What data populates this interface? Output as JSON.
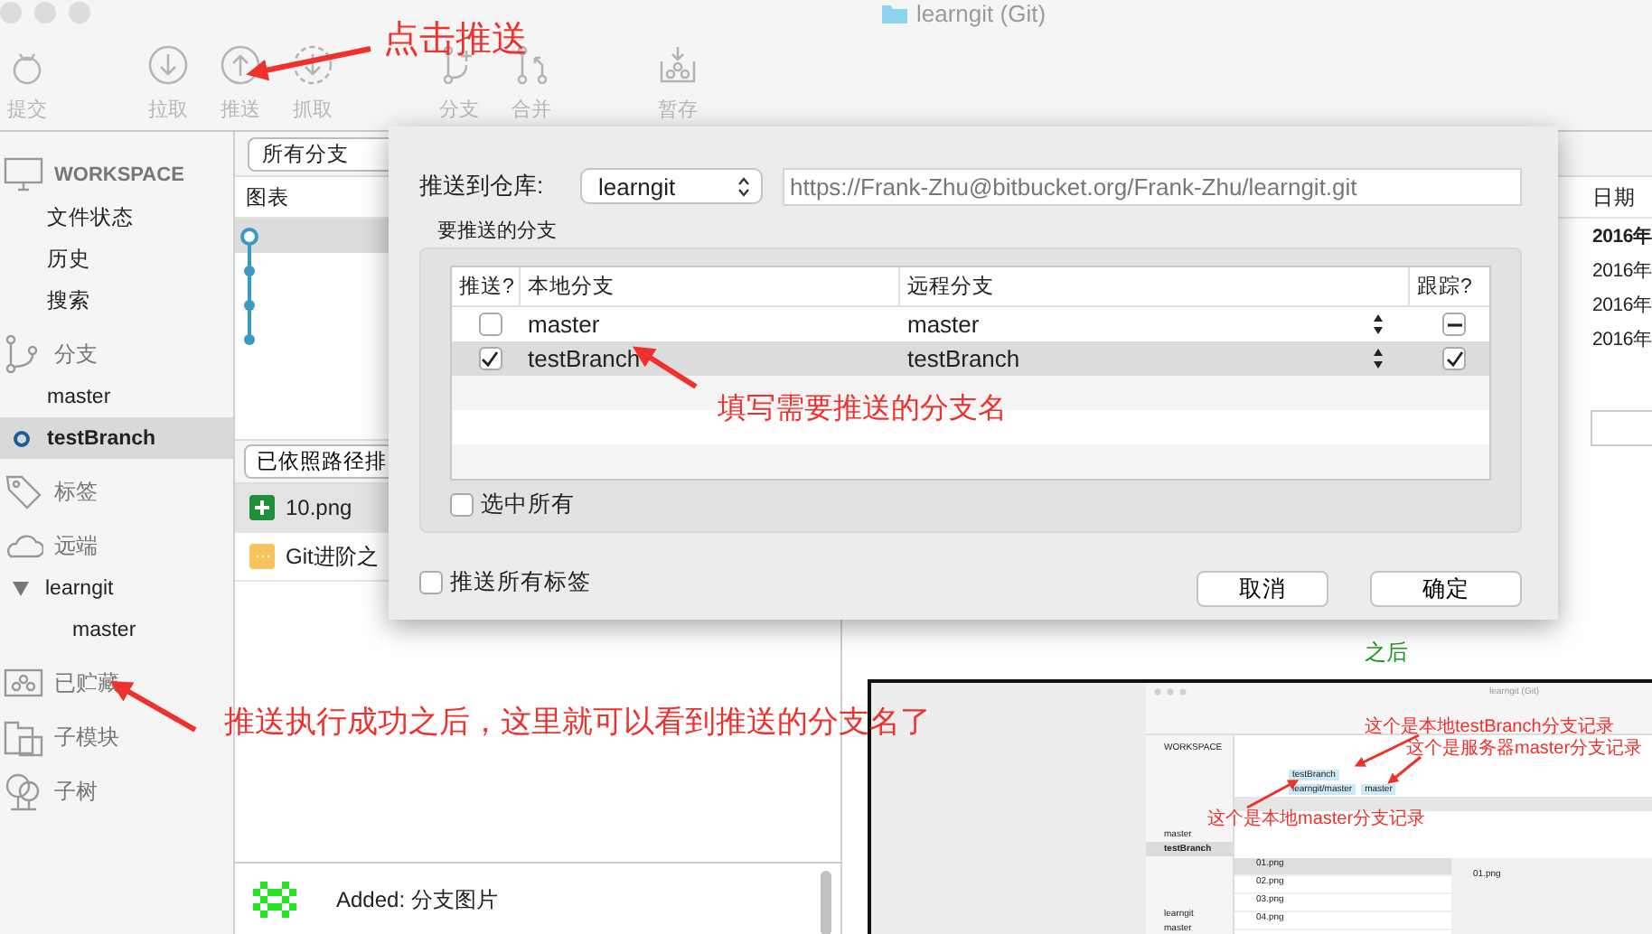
{
  "window": {
    "title": "learngit (Git)"
  },
  "toolbar": [
    {
      "kind": "commit",
      "label": "提交"
    },
    {
      "kind": "pull",
      "label": "拉取"
    },
    {
      "kind": "push",
      "label": "推送"
    },
    {
      "kind": "fetch",
      "label": "抓取"
    },
    {
      "kind": "branch",
      "label": "分支"
    },
    {
      "kind": "merge",
      "label": "合并"
    },
    {
      "kind": "stash",
      "label": "暂存"
    }
  ],
  "sidebar": {
    "sections": [
      {
        "kind": "workspace",
        "label": "WORKSPACE",
        "items": [
          {
            "label": "文件状态",
            "selected": false
          },
          {
            "label": "历史",
            "selected": false
          },
          {
            "label": "搜索",
            "selected": false
          }
        ]
      },
      {
        "kind": "branches",
        "label": "分支",
        "items": [
          {
            "label": "master",
            "selected": false,
            "current": false
          },
          {
            "label": "testBranch",
            "selected": true,
            "current": true
          }
        ]
      },
      {
        "kind": "tags",
        "label": "标签"
      },
      {
        "kind": "remotes",
        "label": "远端",
        "items": [
          {
            "label": "learngit",
            "selected": false,
            "expanded": true,
            "children": [
              {
                "label": "master",
                "selected": false
              }
            ]
          }
        ]
      },
      {
        "kind": "stashes",
        "label": "已贮藏"
      },
      {
        "kind": "submodules",
        "label": "子模块"
      },
      {
        "kind": "subtrees",
        "label": "子树"
      }
    ]
  },
  "history": {
    "branch_filter": "所有分支",
    "columns": [
      "图表"
    ],
    "commits": [
      {
        "selected": true,
        "head": true
      },
      {
        "selected": false,
        "head": false
      },
      {
        "selected": false,
        "head": false
      },
      {
        "selected": false,
        "head": false
      }
    ],
    "sort_button": "已依照路径排",
    "files": [
      {
        "name": "10.png",
        "kind": "added",
        "selected": true
      },
      {
        "name": "Git进阶之",
        "kind": "modified",
        "selected": false
      }
    ],
    "commit_message": "Added: 分支图片"
  },
  "details": {
    "date_column": "日期",
    "dates": [
      {
        "text": "2016年",
        "selected": true
      },
      {
        "text": "2016年",
        "selected": false
      },
      {
        "text": "2016年",
        "selected": false
      },
      {
        "text": "2016年",
        "selected": false
      }
    ],
    "caption": "之后"
  },
  "dialog": {
    "remote_label": "推送到仓库:",
    "remote": "learngit",
    "url": "https://Frank-Zhu@bitbucket.org/Frank-Zhu/learngit.git",
    "group_title": "要推送的分支",
    "columns": [
      "推送?",
      "本地分支",
      "远程分支",
      "跟踪?"
    ],
    "rows": [
      {
        "push": false,
        "local": "master",
        "remote": "master",
        "tracked": false,
        "mixed": true,
        "selected": false
      },
      {
        "push": true,
        "local": "testBranch",
        "remote": "testBranch",
        "tracked": true,
        "mixed": false,
        "selected": true
      }
    ],
    "select_all": {
      "label": "选中所有",
      "checked": false
    },
    "push_tags": {
      "label": "推送所有标签",
      "checked": false
    },
    "buttons": [
      "取消",
      "确定"
    ]
  },
  "annotations": [
    "点击推送",
    "填写需要推送的分支名",
    "推送执行成功之后，这里就可以看到推送的分支名了"
  ],
  "inset": {
    "title": "learngit (Git)",
    "notes": [
      "这个是本地testBranch分支记录",
      "这个是服务器master分支记录",
      "这个是本地master分支记录"
    ],
    "sidebar": [
      {
        "label": "WORKSPACE",
        "selected": false
      },
      {
        "label": "master",
        "selected": false
      },
      {
        "label": "testBranch",
        "selected": true
      },
      {
        "label": "learngit",
        "selected": false
      },
      {
        "label": "master",
        "selected": false
      }
    ],
    "commits": [
      {
        "tags": [
          "testBranch"
        ],
        "selected": false
      },
      {
        "tags": [
          "learngit/master",
          "master"
        ],
        "selected": false
      },
      {
        "selected": true
      }
    ],
    "files": [
      {
        "name": "01.png",
        "selected": true
      },
      {
        "name": "02.png",
        "selected": false
      },
      {
        "name": "03.png",
        "selected": false
      },
      {
        "name": "04.png",
        "selected": false
      }
    ],
    "detail_file": "01.png"
  }
}
